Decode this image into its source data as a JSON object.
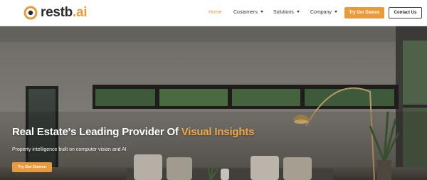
{
  "header": {
    "logo": {
      "text": "restb",
      "accent": ".ai"
    },
    "nav": [
      {
        "label": "Home",
        "active": true,
        "dropdown": false
      },
      {
        "label": "Customers",
        "active": false,
        "dropdown": true
      },
      {
        "label": "Solutions",
        "active": false,
        "dropdown": true
      },
      {
        "label": "Company",
        "active": false,
        "dropdown": true
      }
    ],
    "demos_label": "Try Our Demos",
    "contact_label": "Contact Us"
  },
  "hero": {
    "title_main": "Real Estate's Leading Provider Of ",
    "title_highlight": "Visual Insights",
    "subtitle": "Property intelligence built on computer vision and AI",
    "cta_label": "Try Our Demos"
  },
  "colors": {
    "accent": "#e89a3c",
    "text_dark": "#2a2a2a"
  }
}
